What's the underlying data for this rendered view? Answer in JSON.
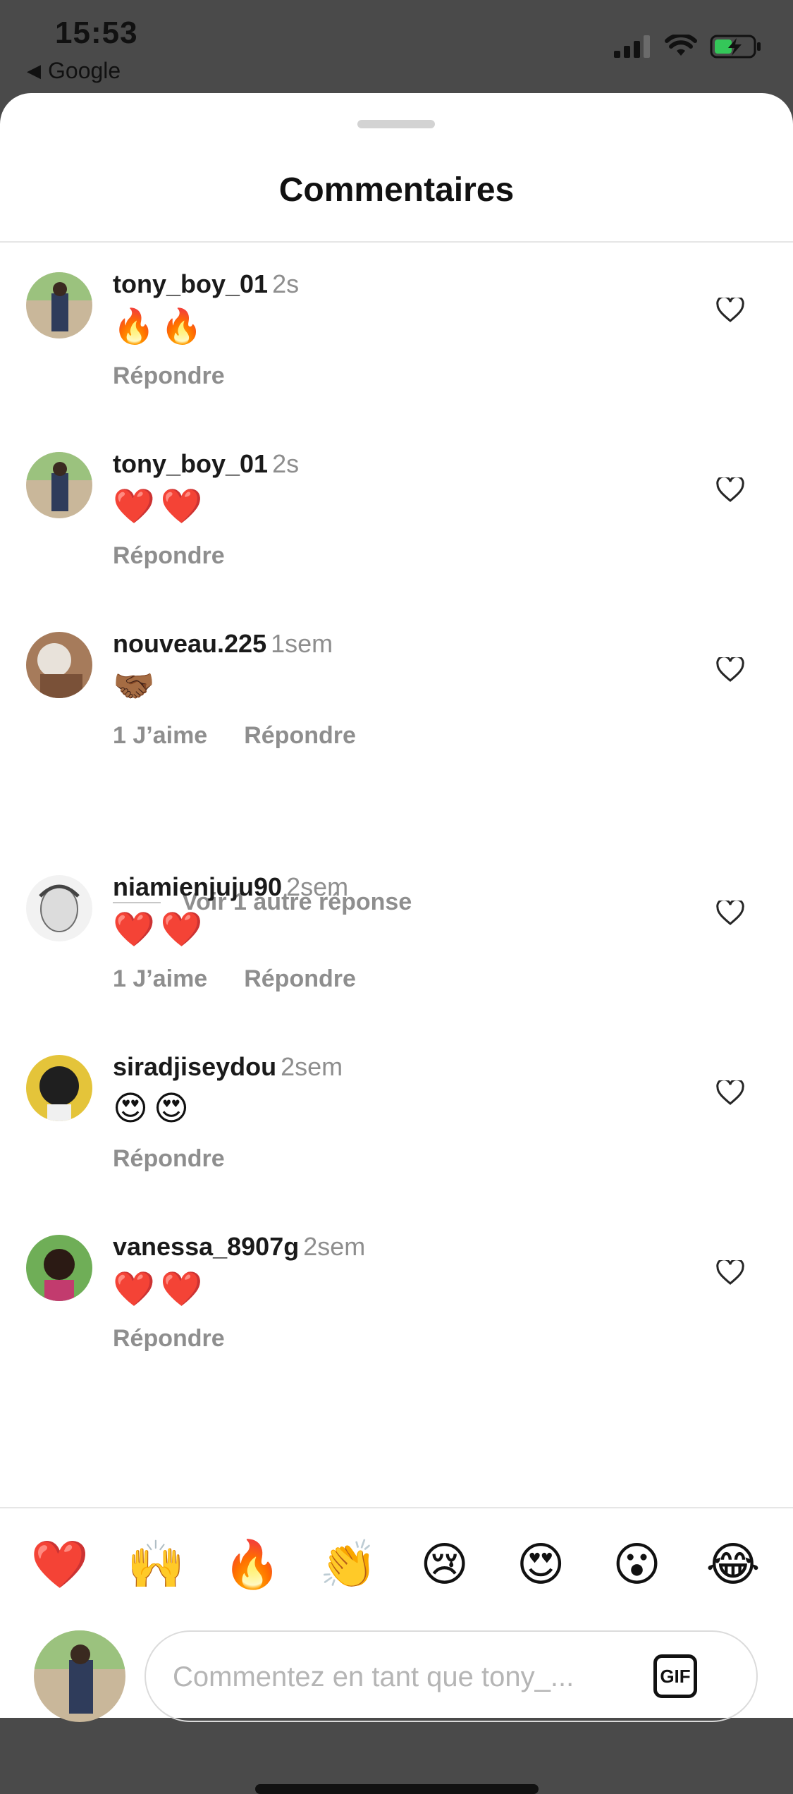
{
  "status": {
    "time": "15:53",
    "back_app": "Google"
  },
  "sheet": {
    "title": "Commentaires"
  },
  "comments": [
    {
      "user": "tony_boy_01",
      "time": "2s",
      "text": "🔥🔥",
      "likes": "",
      "reply": "Répondre"
    },
    {
      "user": "tony_boy_01",
      "time": "2s",
      "text": "❤️❤️",
      "likes": "",
      "reply": "Répondre"
    },
    {
      "user": "nouveau.225",
      "time": "1sem",
      "text": "🤝🏾",
      "likes": "1 J’aime",
      "reply": "Répondre"
    },
    {
      "user": "niamienjuju90",
      "time": "2sem",
      "text": "❤️❤️",
      "likes": "1 J’aime",
      "reply": "Répondre"
    },
    {
      "user": "siradjiseydou",
      "time": "2sem",
      "text": "😍😍",
      "likes": "",
      "reply": "Répondre"
    },
    {
      "user": "vanessa_8907g",
      "time": "2sem",
      "text": "❤️❤️",
      "likes": "",
      "reply": "Répondre"
    }
  ],
  "more_replies": "Voir 1 autre réponse",
  "reactions": [
    "❤️",
    "🙌",
    "🔥",
    "👏",
    "😢",
    "😍",
    "😮",
    "😂"
  ],
  "composer": {
    "placeholder": "Commentez en tant que tony_...",
    "gif_label": "GIF"
  },
  "icons": {
    "heart": "heart-outline-icon",
    "signal": "signal-icon",
    "wifi": "wifi-icon",
    "battery": "battery-charging-icon"
  }
}
